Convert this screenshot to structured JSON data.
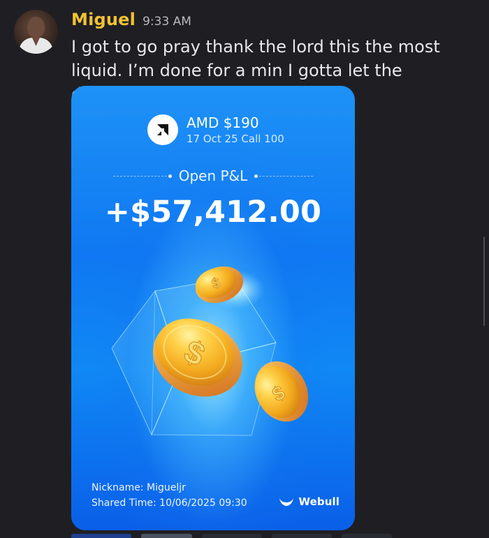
{
  "message": {
    "username": "Miguel",
    "timestamp": "9:33 AM",
    "text": "I got to go pray thank the lord this the most liquid. I’m done for a min I gotta let the dopamine fall off",
    "username_color": "#f1c232"
  },
  "card": {
    "asset": "AMD $190",
    "contract": "17 Oct 25 Call 100",
    "pl_label": "Open P&L",
    "pnl": "+$57,412.00",
    "nickname_label": "Nickname:",
    "nickname": "Migueljr",
    "shared_time_label": "Shared Time:",
    "shared_time": "10/06/2025 09:30",
    "brand": "Webull",
    "accent": "#0f78f2",
    "coin_color": "#f7b21f"
  },
  "icons": {
    "avatar": "avatar",
    "amd": "amd-logo-icon",
    "brand": "webull-icon",
    "coin": "coin-icon"
  }
}
